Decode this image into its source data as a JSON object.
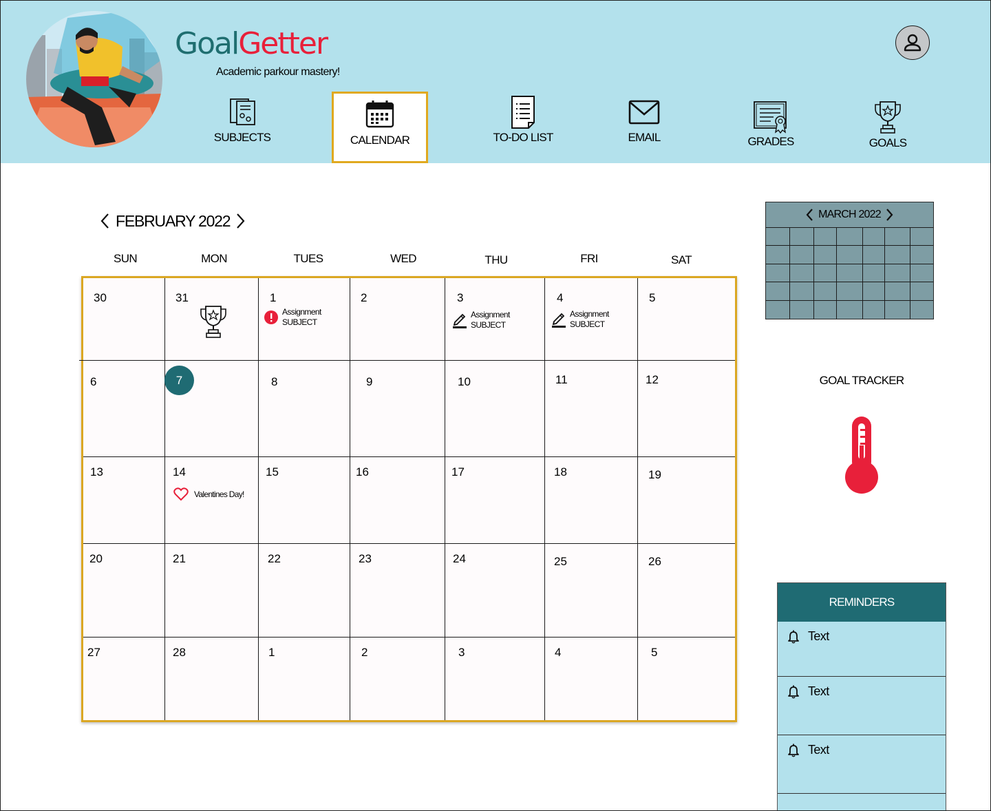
{
  "app": {
    "brand_part1": "Goal",
    "brand_part2": "Getter",
    "tagline": "Academic parkour mastery!"
  },
  "colors": {
    "header_bg": "#b3e1ec",
    "accent_teal": "#1f6b73",
    "brand_red": "#e8203a",
    "active_border": "#e0a91f",
    "mini_calendar_bg": "#7e9da4"
  },
  "profile": {
    "icon": "user-icon"
  },
  "nav": [
    {
      "id": "subjects",
      "label": "SUBJECTS",
      "icon": "subjects-icon",
      "active": false
    },
    {
      "id": "calendar",
      "label": "CALENDAR",
      "icon": "calendar-icon",
      "active": true
    },
    {
      "id": "todo",
      "label": "TO-DO LIST",
      "icon": "todo-list-icon",
      "active": false
    },
    {
      "id": "email",
      "label": "EMAIL",
      "icon": "envelope-icon",
      "active": false
    },
    {
      "id": "grades",
      "label": "GRADES",
      "icon": "certificate-icon",
      "active": false
    },
    {
      "id": "goals",
      "label": "GOALS",
      "icon": "trophy-icon",
      "active": false
    }
  ],
  "calendar": {
    "month_label": "FEBRUARY 2022",
    "weekdays": [
      "SUN",
      "MON",
      "TUES",
      "WED",
      "THU",
      "FRI",
      "SAT"
    ],
    "weeks": [
      [
        "30",
        "31",
        "1",
        "2",
        "3",
        "4",
        "5"
      ],
      [
        "6",
        "7",
        "8",
        "9",
        "10",
        "11",
        "12"
      ],
      [
        "13",
        "14",
        "15",
        "16",
        "17",
        "18",
        "19"
      ],
      [
        "20",
        "21",
        "22",
        "23",
        "24",
        "25",
        "26"
      ],
      [
        "27",
        "28",
        "1",
        "2",
        "3",
        "4",
        "5"
      ]
    ],
    "today": "7",
    "events": {
      "goal_day_31": {
        "icon": "trophy-icon"
      },
      "day_1": {
        "icon": "alert-icon",
        "title": "Assignment",
        "subtitle": "SUBJECT"
      },
      "day_3": {
        "icon": "pencil-icon",
        "title": "Assignment",
        "subtitle": "SUBJECT"
      },
      "day_4": {
        "icon": "pencil-icon",
        "title": "Assignment",
        "subtitle": "SUBJECT"
      },
      "day_14": {
        "icon": "heart-icon",
        "title": "Valentines Day!"
      }
    }
  },
  "mini_calendar": {
    "month_label": "MARCH 2022",
    "rows": 5,
    "cols": 7
  },
  "goal_tracker": {
    "title": "GOAL TRACKER",
    "icon": "thermometer-icon"
  },
  "reminders": {
    "title": "REMINDERS",
    "items": [
      {
        "text": "Text",
        "icon": "bell-icon"
      },
      {
        "text": "Text",
        "icon": "bell-icon"
      },
      {
        "text": "Text",
        "icon": "bell-icon"
      }
    ]
  }
}
